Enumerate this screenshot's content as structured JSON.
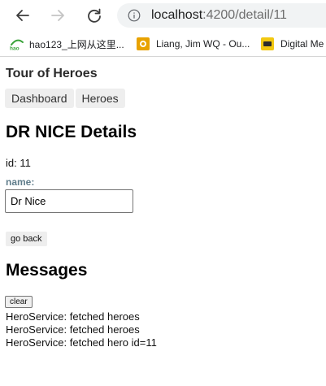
{
  "browser": {
    "url_host": "localhost",
    "url_path": ":4200/detail/11",
    "bookmarks": [
      {
        "label": "hao123_上网从这里...",
        "icon": "hao123-icon"
      },
      {
        "label": "Liang, Jim WQ - Ou...",
        "icon": "outlook-icon"
      },
      {
        "label": "Digital Me",
        "icon": "digital-media-icon"
      }
    ],
    "colors": {
      "hao_green": "#3aa33a",
      "outlook_orange": "#e8a200",
      "digital_yellow": "#f2c811"
    }
  },
  "app": {
    "title": "Tour of Heroes",
    "nav": [
      {
        "label": "Dashboard"
      },
      {
        "label": "Heroes"
      }
    ]
  },
  "hero_detail": {
    "title": "DR NICE Details",
    "id_line": "id: 11",
    "name_label": "name:",
    "name_value": "Dr Nice",
    "go_back_label": "go back"
  },
  "messages": {
    "title": "Messages",
    "clear_label": "clear",
    "items": [
      "HeroService: fetched heroes",
      "HeroService: fetched heroes",
      "HeroService: fetched hero id=11"
    ]
  }
}
